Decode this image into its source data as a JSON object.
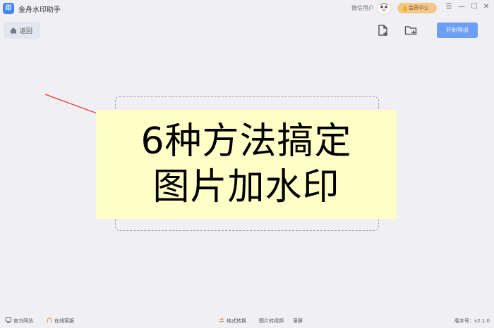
{
  "app": {
    "logo_char": "印",
    "title": "金舟水印助手",
    "user_name": "微信用户",
    "member_label": "会员中心",
    "member_icon": "thumb-up-icon",
    "window_controls": [
      "☰",
      "—",
      "☐",
      "✕"
    ]
  },
  "toolbar": {
    "back_label": "返回",
    "add_file_icon": "add-file-icon",
    "add_folder_icon": "add-folder-icon",
    "export_label": "开始导出"
  },
  "banner": {
    "line1": "6种方法搞定",
    "line2": "图片加水印",
    "background": "#ffffc8"
  },
  "statusbar": {
    "website": "官方网站",
    "support": "在线客服",
    "format_convert": "格式转换",
    "image_to_video": "图片转视频",
    "screen_record": "录屏",
    "version": "版本号：v2.1.0"
  },
  "colors": {
    "accent": "#6b9ef5",
    "logo": "#3f86f5",
    "member": "#f3c88a",
    "arrow": "#e53935"
  }
}
